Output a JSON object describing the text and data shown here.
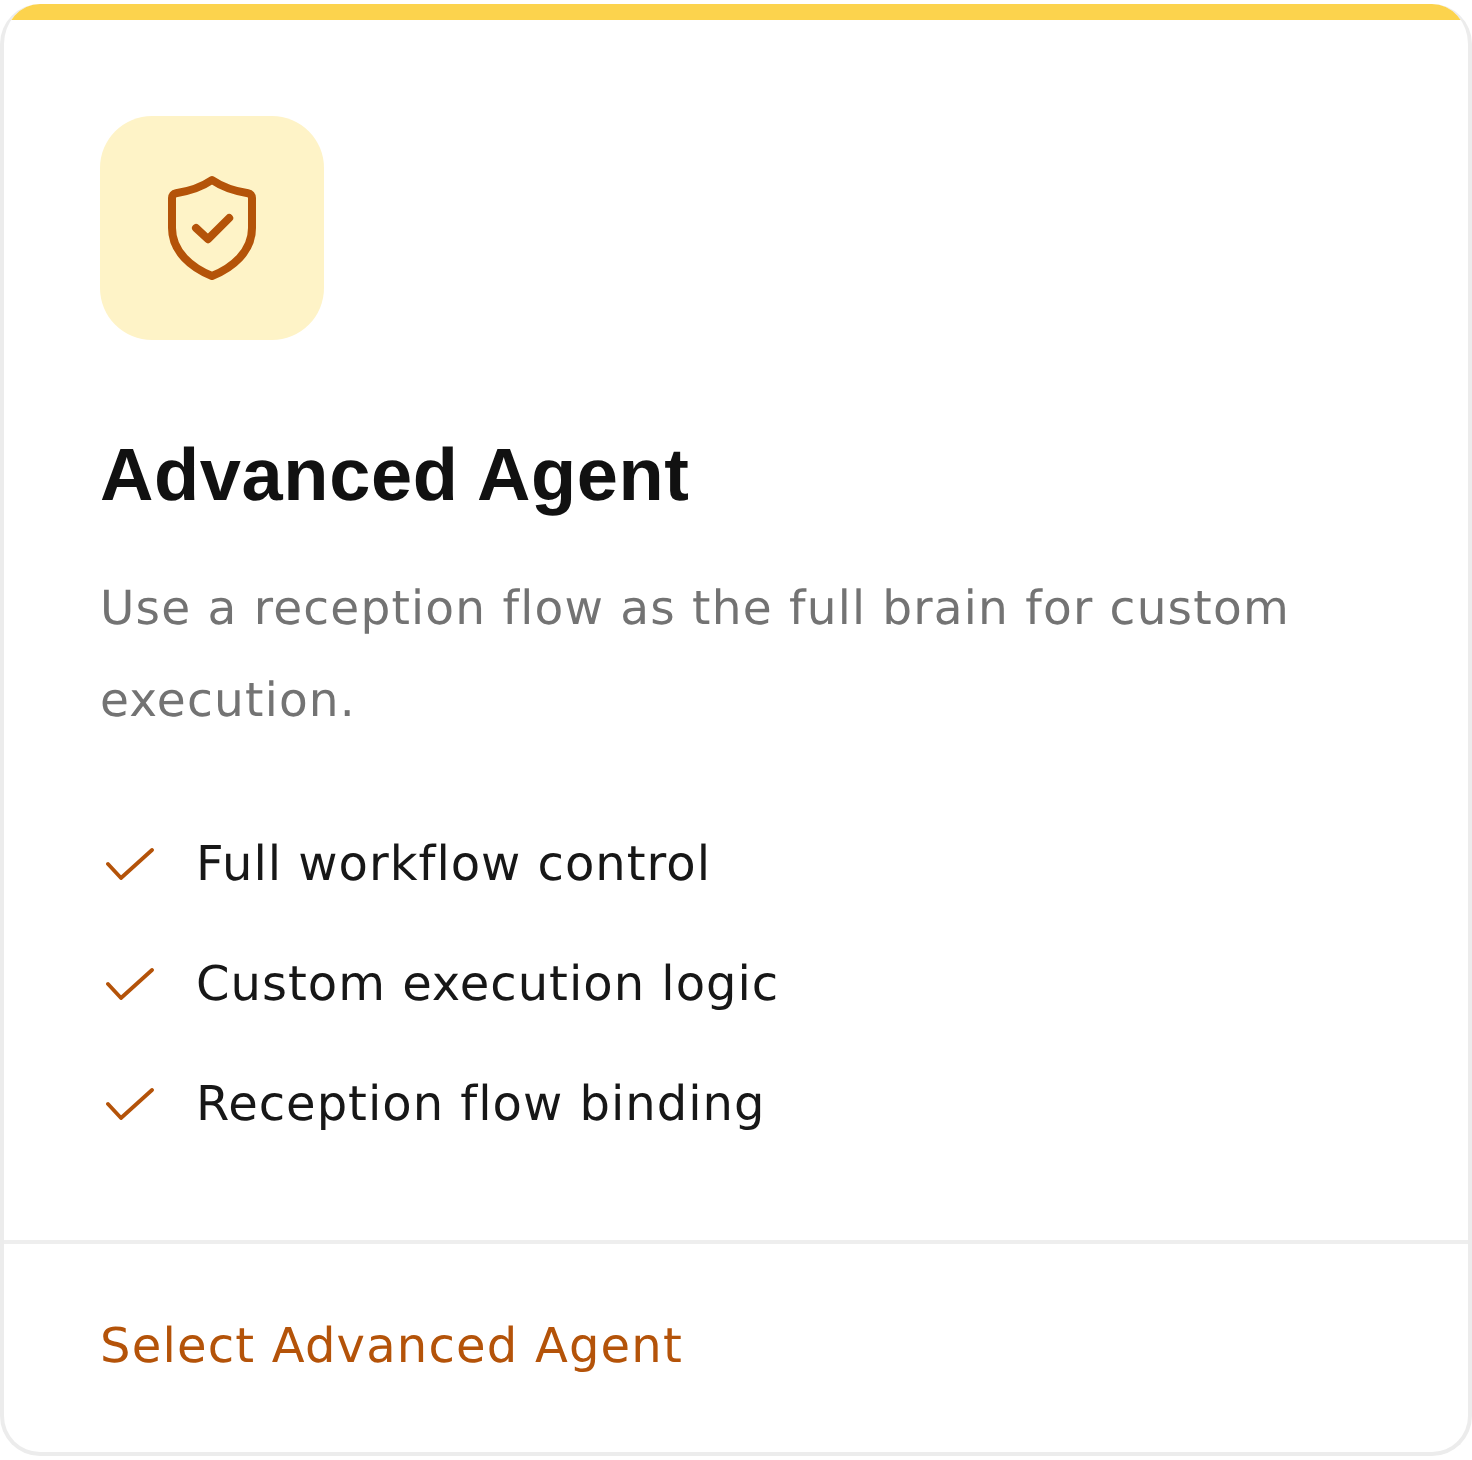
{
  "card": {
    "title": "Advanced Agent",
    "description": "Use a reception flow as the full brain for custom execution.",
    "features": [
      "Full workflow control",
      "Custom execution logic",
      "Reception flow binding"
    ],
    "action": "Select Advanced Agent"
  }
}
